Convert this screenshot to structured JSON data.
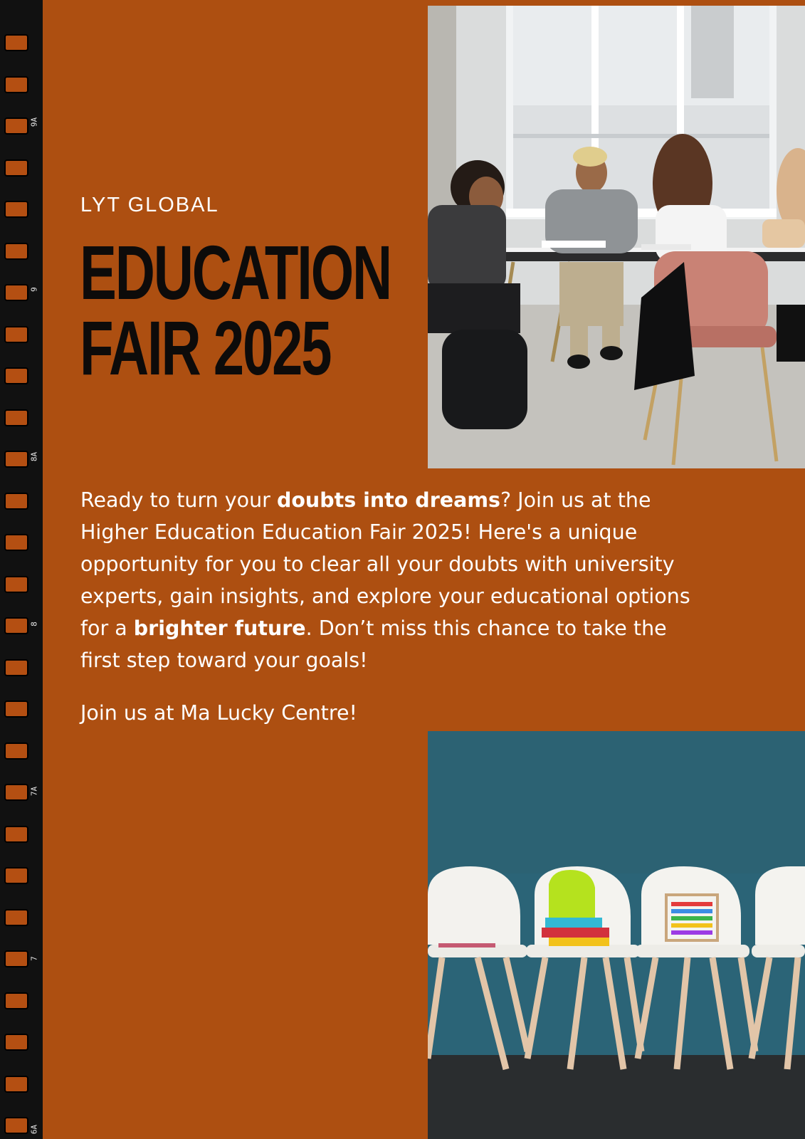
{
  "brand": "LYT GLOBAL",
  "title_line1": "EDUCATION",
  "title_line2": "FAIR 2025",
  "body": {
    "p1_a": "Ready to turn your ",
    "p1_b": "doubts into dreams",
    "p1_c": "? Join us at the Higher Education Education Fair 2025! Here's a unique opportunity for you to clear all your doubts with university experts, gain insights, and explore your educational options for a ",
    "p1_d": "brighter future",
    "p1_e": ". Don’t miss this chance to take the first step toward your goals!"
  },
  "cta": "Join us at Ma Lucky Centre!",
  "film_marks": [
    "9A",
    "9",
    "8A",
    "8",
    "7A",
    "7",
    "6A"
  ],
  "colors": {
    "background": "#ad4f11",
    "title": "#0d0b0a",
    "text": "#ffffff",
    "film": "#111111"
  }
}
